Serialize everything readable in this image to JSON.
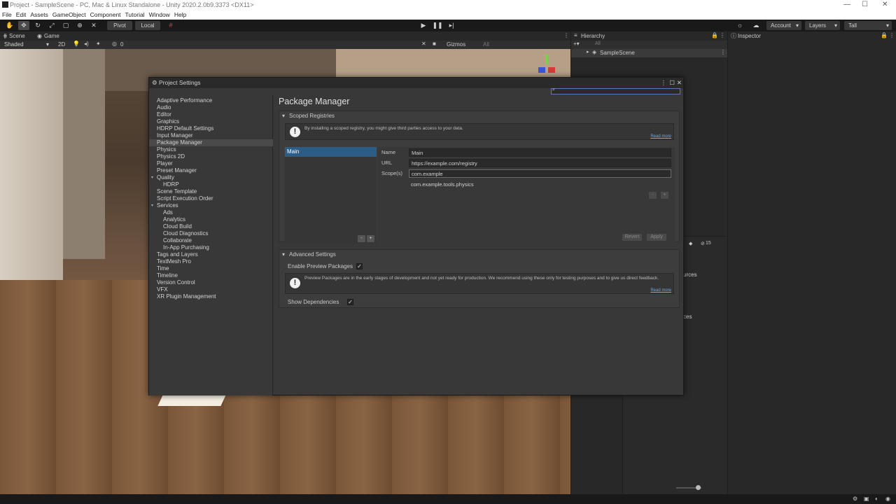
{
  "titlebar": {
    "title": "Project - SampleScene - PC, Mac & Linux Standalone - Unity 2020.2.0b9.3373 <DX11>",
    "minimize": "—",
    "maximize": "☐",
    "close": "✕"
  },
  "menu": [
    "File",
    "Edit",
    "Assets",
    "GameObject",
    "Component",
    "Tutorial",
    "Window",
    "Help"
  ],
  "toolbar": {
    "pivot": "Pivot",
    "local": "Local",
    "account": "Account",
    "layers": "Layers",
    "layout": "Tall"
  },
  "scene": {
    "tab_scene": "Scene",
    "tab_game": "Game",
    "shading": "Shaded",
    "mode_2d": "2D",
    "gizmos": "Gizmos",
    "search_all": "All",
    "hidden_count": "0"
  },
  "hierarchy": {
    "tab": "Hierarchy",
    "search": "All",
    "root": "SampleScene"
  },
  "inspector": {
    "tab": "Inspector"
  },
  "project_panel": {
    "count": "15",
    "frag1": "urces",
    "frag2": "ces"
  },
  "project_settings": {
    "title": "Project Settings",
    "sidebar": [
      "Adaptive Performance",
      "Audio",
      "Editor",
      "Graphics",
      "HDRP Default Settings",
      "Input Manager",
      "Package Manager",
      "Physics",
      "Physics 2D",
      "Player",
      "Preset Manager",
      "Quality",
      "HDRP",
      "Scene Template",
      "Script Execution Order",
      "Services",
      "Ads",
      "Analytics",
      "Cloud Build",
      "Cloud Diagnostics",
      "Collaborate",
      "In-App Purchasing",
      "Tags and Layers",
      "TextMesh Pro",
      "Time",
      "Timeline",
      "Version Control",
      "VFX",
      "XR Plugin Management"
    ],
    "selected": "Package Manager",
    "page_title": "Package Manager",
    "scoped": {
      "header": "Scoped Registries",
      "info": "By installing a scoped registry, you might give third parties access to your data.",
      "read_more": "Read more",
      "registry_name": "Main",
      "labels": {
        "name": "Name",
        "url": "URL",
        "scopes": "Scope(s)"
      },
      "values": {
        "name": "Main",
        "url": "https://example.com/registry",
        "scope1": "com.example",
        "scope2": "com.example.tools.physics"
      },
      "minus": "-",
      "plus": "+",
      "revert": "Revert",
      "apply": "Apply"
    },
    "advanced": {
      "header": "Advanced Settings",
      "enable_preview": "Enable Preview Packages",
      "info": "Preview Packages are in the early stages of development and not yet ready for production. We recommend using these only for testing purposes and to give us direct feedback.",
      "read_more": "Read more",
      "show_deps": "Show Dependencies",
      "enable_preview_checked": true,
      "show_deps_checked": true
    }
  }
}
